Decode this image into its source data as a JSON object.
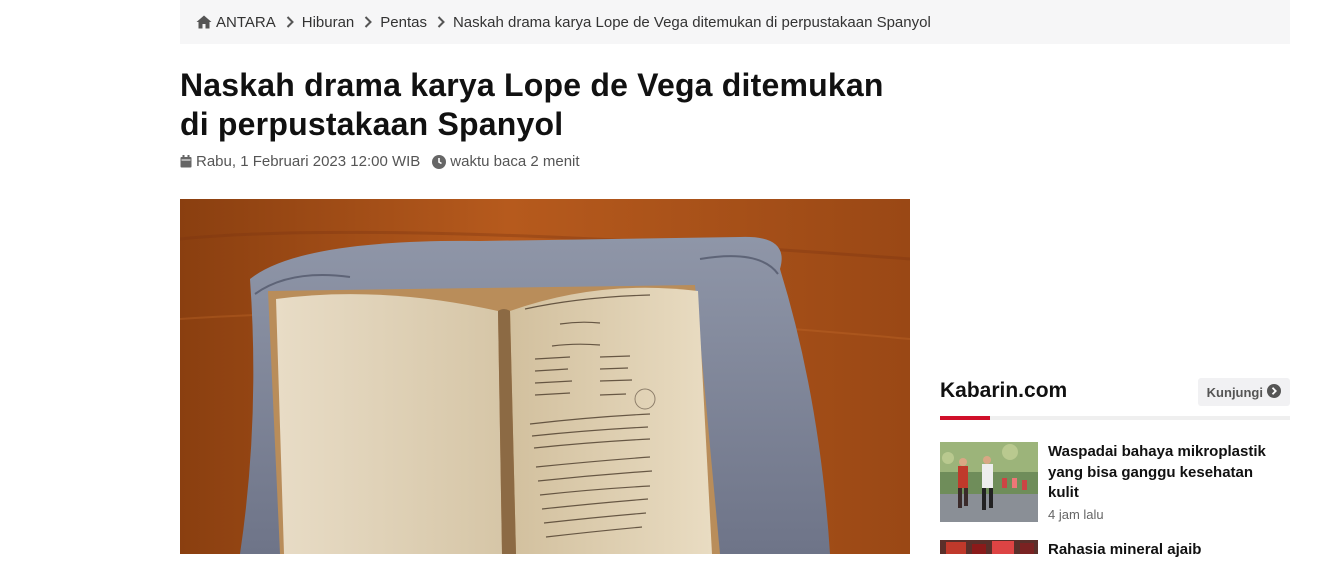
{
  "breadcrumb": {
    "items": [
      "ANTARA",
      "Hiburan",
      "Pentas",
      "Naskah drama karya Lope de Vega ditemukan di perpustakaan Spanyol"
    ]
  },
  "article": {
    "title": "Naskah drama karya Lope de Vega ditemukan di perpustakaan Spanyol",
    "date": "Rabu, 1 Februari 2023 12:00 WIB",
    "reading_time": "waktu baca 2 menit"
  },
  "sidebar": {
    "source_name": "Kabarin.com",
    "visit_label": "Kunjungi",
    "accent_color": "#d0102a",
    "items": [
      {
        "headline": "Waspadai bahaya mikroplastik yang bisa ganggu kesehatan kulit",
        "time": "4 jam lalu"
      },
      {
        "headline": "Rahasia mineral ajaib"
      }
    ]
  },
  "icons": [
    "home-icon",
    "chevron-right-icon",
    "calendar-icon",
    "clock-icon",
    "arrow-right-circle-icon"
  ]
}
